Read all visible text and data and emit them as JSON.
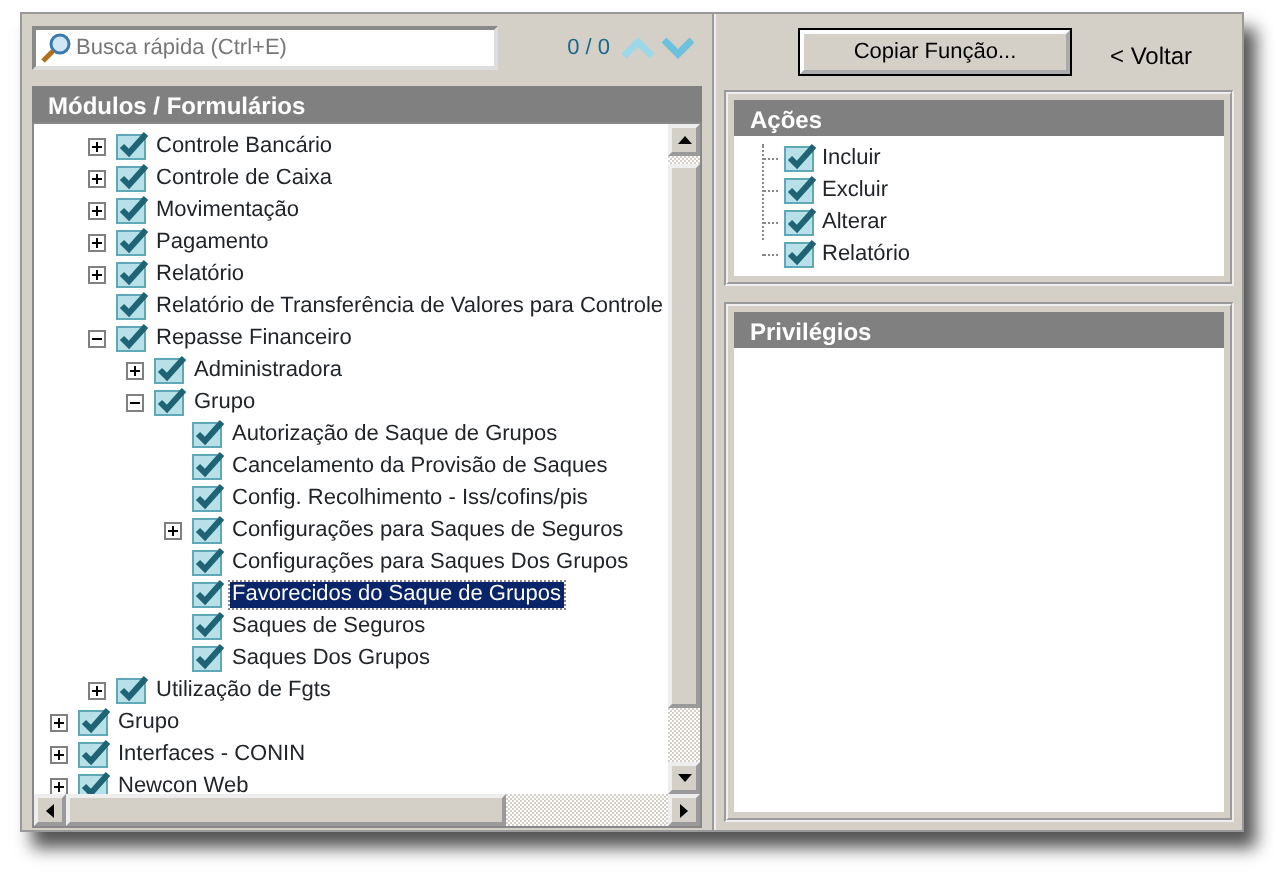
{
  "search": {
    "placeholder": "Busca rápida (Ctrl+E)",
    "count": "0 / 0"
  },
  "modules": {
    "title": "Módulos / Formulários",
    "items": [
      {
        "children": [
          {
            "label": "Controle Bancário",
            "checked": true,
            "selected": false,
            "expanded": false
          },
          {
            "label": "Controle de Caixa",
            "checked": true,
            "selected": false,
            "expanded": false
          },
          {
            "label": "Movimentação",
            "checked": true,
            "selected": false,
            "expanded": false
          },
          {
            "label": "Pagamento",
            "checked": true,
            "selected": false,
            "expanded": false
          },
          {
            "label": "Relatório",
            "checked": true,
            "selected": false,
            "expanded": false
          },
          {
            "label": "Relatório de Transferência de Valores para Controle",
            "checked": true,
            "selected": false
          },
          {
            "label": "Repasse Financeiro",
            "checked": true,
            "selected": false,
            "expanded": true,
            "children": [
              {
                "label": "Administradora",
                "checked": true,
                "selected": false,
                "expanded": false
              },
              {
                "label": "Grupo",
                "checked": true,
                "selected": false,
                "expanded": true,
                "children": [
                  {
                    "label": "Autorização de Saque de Grupos",
                    "checked": true,
                    "selected": false
                  },
                  {
                    "label": "Cancelamento da Provisão de Saques",
                    "checked": true,
                    "selected": false
                  },
                  {
                    "label": "Config. Recolhimento - Iss/cofins/pis",
                    "checked": true,
                    "selected": false
                  },
                  {
                    "label": "Configurações para Saques de Seguros",
                    "checked": true,
                    "selected": false,
                    "expanded": false
                  },
                  {
                    "label": "Configurações para Saques Dos Grupos",
                    "checked": true,
                    "selected": false
                  },
                  {
                    "label": "Favorecidos do Saque de Grupos",
                    "checked": true,
                    "selected": true
                  },
                  {
                    "label": "Saques de Seguros",
                    "checked": true,
                    "selected": false
                  },
                  {
                    "label": "Saques Dos Grupos",
                    "checked": true,
                    "selected": false
                  }
                ]
              }
            ]
          },
          {
            "label": "Utilização de Fgts",
            "checked": true,
            "selected": false,
            "expanded": false
          }
        ]
      },
      {
        "label": "Grupo",
        "checked": true,
        "selected": false,
        "expanded": false
      },
      {
        "label": "Interfaces - CONIN",
        "checked": true,
        "selected": false,
        "expanded": false
      },
      {
        "label": "Newcon Web",
        "checked": true,
        "selected": false,
        "expanded": false
      }
    ]
  },
  "copy_button": "Copiar Função...",
  "back_link": "< Voltar",
  "actions": {
    "title": "Ações",
    "items": [
      {
        "label": "Incluir",
        "checked": true
      },
      {
        "label": "Excluir",
        "checked": true
      },
      {
        "label": "Alterar",
        "checked": true
      },
      {
        "label": "Relatório",
        "checked": true
      }
    ]
  },
  "privileges": {
    "title": "Privilégios"
  }
}
